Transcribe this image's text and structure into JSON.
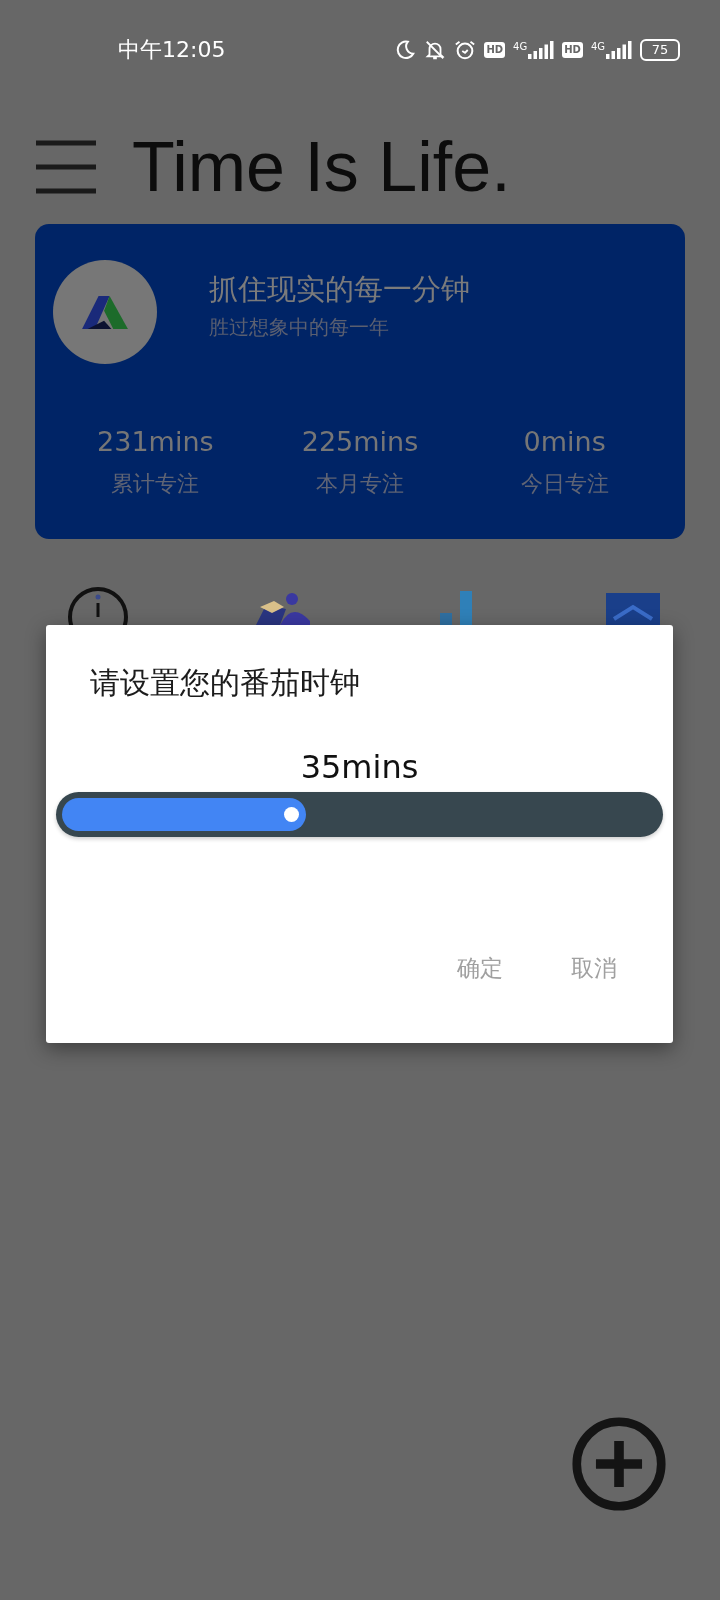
{
  "status_bar": {
    "time": "中午12:05",
    "battery": "75",
    "sims": [
      {
        "hd": "HD",
        "network": "4G"
      },
      {
        "hd": "HD",
        "network": "4G"
      }
    ]
  },
  "header": {
    "title": "Time Is Life."
  },
  "profile_card": {
    "headline": "抓住现实的每一分钟",
    "subline": "胜过想象中的每一年",
    "stats": [
      {
        "value": "231mins",
        "label": "累计专注"
      },
      {
        "value": "225mins",
        "label": "本月专注"
      },
      {
        "value": "0mins",
        "label": "今日专注"
      }
    ]
  },
  "dialog": {
    "title": "请设置您的番茄时钟",
    "reading": "35mins",
    "slider": {
      "level": 0.41
    },
    "buttons": [
      "确定",
      "取消"
    ]
  }
}
